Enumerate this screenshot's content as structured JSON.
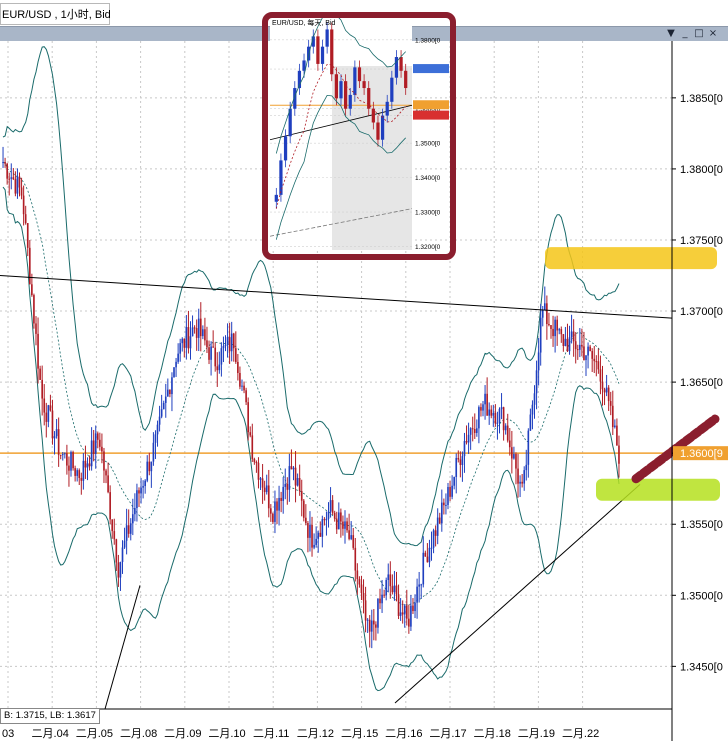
{
  "window": {
    "title": "EUR/USD , 1小时, Bid",
    "buttons": [
      "▼",
      "_",
      "□",
      "×"
    ]
  },
  "status_text": "B: 1.3715, LB: 1.3617",
  "chart_data": {
    "type": "candlestick",
    "symbol": "EUR/USD",
    "timeframe": "1小时",
    "price_type": "Bid",
    "y_ticks": [
      "1.3850[0",
      "1.3800[0",
      "1.3750[0",
      "1.3700[0",
      "1.3650[0",
      "1.3600[9",
      "1.3550[0",
      "1.3500[0",
      "1.3450[0"
    ],
    "y_tick_values": [
      1.385,
      1.38,
      1.375,
      1.37,
      1.365,
      1.36,
      1.355,
      1.35,
      1.345
    ],
    "current_price_label": "1.3600[9",
    "current_price": 1.36,
    "x_ticks": [
      "03",
      "二月.04",
      "二月.05",
      "二月.08",
      "二月.09",
      "二月.10",
      "二月.11",
      "二月.12",
      "二月.15",
      "二月.16",
      "二月.17",
      "二月.18",
      "二月.19",
      "二月.22"
    ],
    "ylim": [
      1.342,
      1.389
    ],
    "grid": true,
    "indicators": [
      "Bollinger Bands",
      "trend lines"
    ],
    "colors": {
      "bull": "#1f3fbf",
      "bear": "#b01c24",
      "band": "#1a6b6b",
      "price_line": "#f0a030",
      "grid": "#c8c8c8"
    },
    "close_path": [
      1.3805,
      1.3782,
      1.364,
      1.36,
      1.3585,
      1.3612,
      1.352,
      1.357,
      1.361,
      1.367,
      1.369,
      1.3665,
      1.368,
      1.36,
      1.356,
      1.359,
      1.354,
      1.356,
      1.354,
      1.347,
      1.351,
      1.348,
      1.353,
      1.3565,
      1.361,
      1.3635,
      1.3625,
      1.357,
      1.37,
      1.368,
      1.3675,
      1.366,
      1.36
    ]
  },
  "inset": {
    "title": "EUR/USD, 每天, Bid",
    "y_ticks": [
      "1.3800[0",
      "1.3715[0",
      "1.3600[0",
      "1.3580[0",
      "1.3500[0",
      "1.3400[0",
      "1.3300[0",
      "1.3200[0"
    ]
  }
}
